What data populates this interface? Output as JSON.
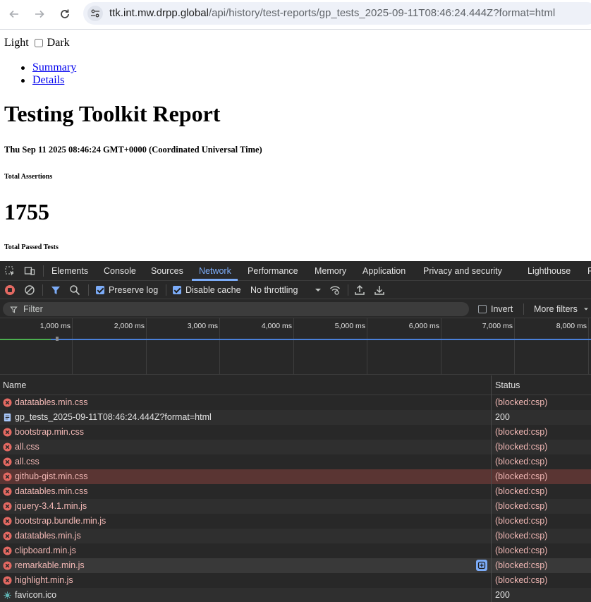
{
  "browser": {
    "url_host": "ttk.int.mw.drpp.global",
    "url_path": "/api/history/test-reports/gp_tests_2025-09-11T08:46:24.444Z?format=html"
  },
  "page": {
    "theme_light": "Light",
    "theme_dark": "Dark",
    "nav": [
      "Summary",
      "Details"
    ],
    "title": "Testing Toolkit Report",
    "date": "Thu Sep 11 2025 08:46:24 GMT+0000 (Coordinated Universal Time)",
    "total_assertions_label": "Total Assertions",
    "total_assertions_value": "1755",
    "total_passed_label": "Total Passed Tests"
  },
  "devtools": {
    "tabs": [
      "Elements",
      "Console",
      "Sources",
      "Network",
      "Performance",
      "Memory",
      "Application",
      "Privacy and security",
      "Lighthouse",
      "R"
    ],
    "active_tab": "Network",
    "toolbar": {
      "preserve_log": "Preserve log",
      "disable_cache": "Disable cache",
      "throttling": "No throttling"
    },
    "filter": {
      "placeholder": "Filter",
      "invert": "Invert",
      "more_filters": "More filters"
    },
    "timeline_labels": [
      "1,000 ms",
      "2,000 ms",
      "3,000 ms",
      "4,000 ms",
      "5,000 ms",
      "6,000 ms",
      "7,000 ms",
      "8,000 ms"
    ],
    "columns": {
      "name": "Name",
      "status": "Status"
    },
    "requests": [
      {
        "name": "datatables.min.css",
        "status": "(blocked:csp)",
        "type": "error"
      },
      {
        "name": "gp_tests_2025-09-11T08:46:24.444Z?format=html",
        "status": "200",
        "type": "doc"
      },
      {
        "name": "bootstrap.min.css",
        "status": "(blocked:csp)",
        "type": "error"
      },
      {
        "name": "all.css",
        "status": "(blocked:csp)",
        "type": "error"
      },
      {
        "name": "all.css",
        "status": "(blocked:csp)",
        "type": "error"
      },
      {
        "name": "github-gist.min.css",
        "status": "(blocked:csp)",
        "type": "error"
      },
      {
        "name": "datatables.min.css",
        "status": "(blocked:csp)",
        "type": "error"
      },
      {
        "name": "jquery-3.4.1.min.js",
        "status": "(blocked:csp)",
        "type": "error"
      },
      {
        "name": "bootstrap.bundle.min.js",
        "status": "(blocked:csp)",
        "type": "error"
      },
      {
        "name": "datatables.min.js",
        "status": "(blocked:csp)",
        "type": "error"
      },
      {
        "name": "clipboard.min.js",
        "status": "(blocked:csp)",
        "type": "error"
      },
      {
        "name": "remarkable.min.js",
        "status": "(blocked:csp)",
        "type": "error"
      },
      {
        "name": "highlight.min.js",
        "status": "(blocked:csp)",
        "type": "error"
      },
      {
        "name": "favicon.ico",
        "status": "200",
        "type": "image"
      }
    ],
    "selected_row": 5,
    "hover_row": 11
  },
  "icons": {
    "back": "back-arrow-icon",
    "forward": "forward-arrow-icon",
    "reload": "reload-icon",
    "site_info": "site-settings-icon",
    "error": "error-circle-icon",
    "document": "document-icon",
    "favicon": "favicon-icon"
  },
  "colors": {
    "active_tab": "#7cacf8",
    "error_text": "#f2b8b5",
    "error_icon": "#e46962",
    "devtools_bg": "#282828",
    "selected_row": "#5a3533"
  }
}
